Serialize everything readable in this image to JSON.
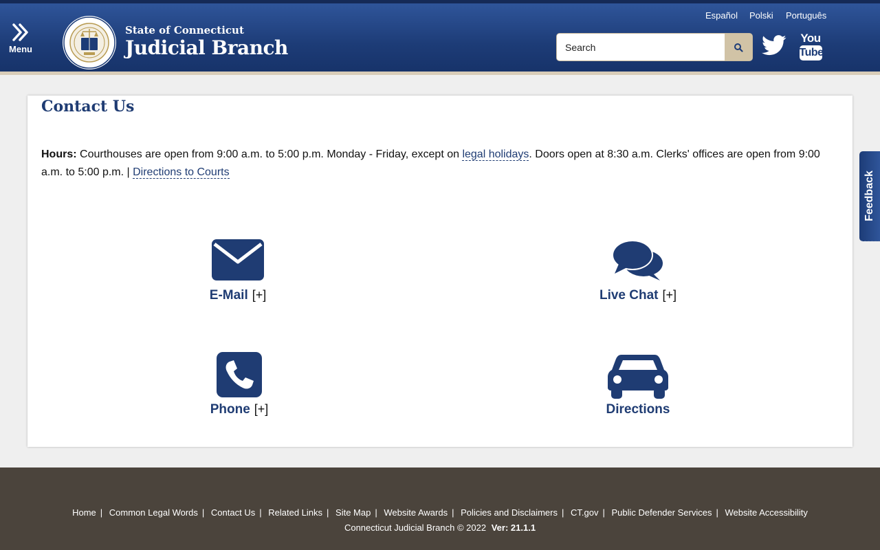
{
  "header": {
    "menu_label": "Menu",
    "brand_sub": "State of Connecticut",
    "brand_main": "Judicial Branch",
    "languages": [
      "Español",
      "Polski",
      "Português"
    ],
    "search_placeholder": "Search",
    "colors": {
      "header_bg": "#1d3c77",
      "accent": "#d1c3a6"
    }
  },
  "page": {
    "title": "Contact Us",
    "hours_label": "Hours:",
    "hours_text_1": "Courthouses are open from 9:00 a.m. to 5:00 p.m. Monday - Friday, except on",
    "legal_holidays_link": "legal holidays",
    "hours_text_2": ". Doors open at 8:30 a.m. Clerks' offices are open from 9:00 a.m. to 5:00 p.m. |",
    "directions_link": "Directions to Courts"
  },
  "contacts": [
    {
      "label": "E-Mail",
      "expand": "[+]",
      "icon": "envelope-icon"
    },
    {
      "label": "Live Chat",
      "expand": "[+]",
      "icon": "chat-bubbles-icon"
    },
    {
      "label": "Phone",
      "expand": "[+]",
      "icon": "phone-icon"
    },
    {
      "label": "Directions",
      "icon": "car-icon"
    }
  ],
  "feedback_label": "Feedback",
  "footer": {
    "links": [
      "Home",
      "Common Legal Words",
      "Contact Us",
      "Related Links",
      "Site Map",
      "Website Awards",
      "Policies and Disclaimers",
      "CT.gov",
      "Public Defender Services",
      "Website Accessibility"
    ],
    "separator": "|",
    "copyright": "Connecticut Judicial Branch © 2022",
    "version": "Ver: 21.1.1"
  }
}
